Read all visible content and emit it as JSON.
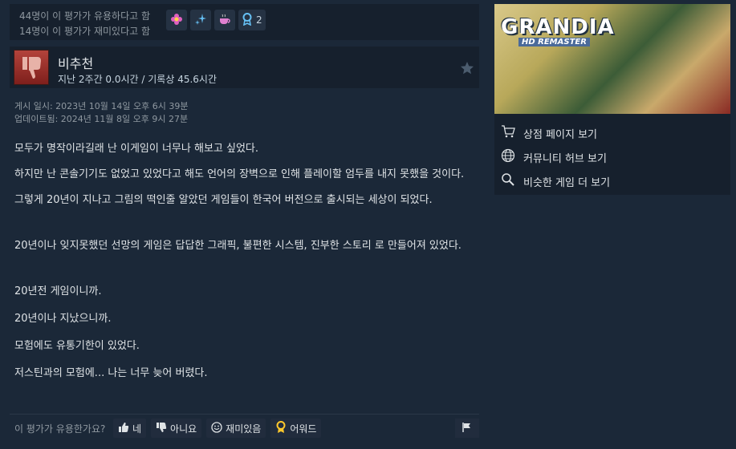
{
  "review_stats": {
    "helpful_line": "44명이 이 평가가 유용하다고 함",
    "funny_line": "14명이 이 평가가 재미있다고 함",
    "award_count": "2"
  },
  "review": {
    "verdict": "비추천",
    "hours": "지난 2주간 0.0시간 / 기록상 45.6시간",
    "posted": "게시 일시: 2023년 10월 14일 오후 6시 39분",
    "updated": "업데이트됨: 2024년 11월 8일 오후 9시 27분",
    "paragraphs": [
      "모두가 명작이라길래 난 이게임이 너무나 해보고 싶었다.",
      "하지만 난 콘솔기기도 없었고 있었다고 해도 언어의 장벽으로 인해 플레이할 엄두를 내지 못했을 것이다.",
      "그렇게 20년이 지나고 그림의 떡인줄 알았던 게임들이 한국어 버전으로 출시되는 세상이 되었다.",
      "20년이나 잊지못했던 선망의 게임은 답답한 그래픽, 불편한 시스템, 진부한 스토리 로 만들어져 있었다.",
      "20년전 게임이니까.",
      "20년이나 지났으니까.",
      "모험에도 유통기한이 있었다.",
      "저스틴과의 모험에... 나는 너무 늦어 버렸다."
    ]
  },
  "feedback": {
    "question": "이 평가가 유용한가요?",
    "yes": "네",
    "no": "아니요",
    "funny": "재미있음",
    "award": "어워드"
  },
  "sidebar": {
    "logo_text": "GRANDIA",
    "logo_sub": "HD REMASTER",
    "store_link": "상점 페이지 보기",
    "community_link": "커뮤니티 허브 보기",
    "similar_link": "비슷한 게임 더 보기"
  }
}
